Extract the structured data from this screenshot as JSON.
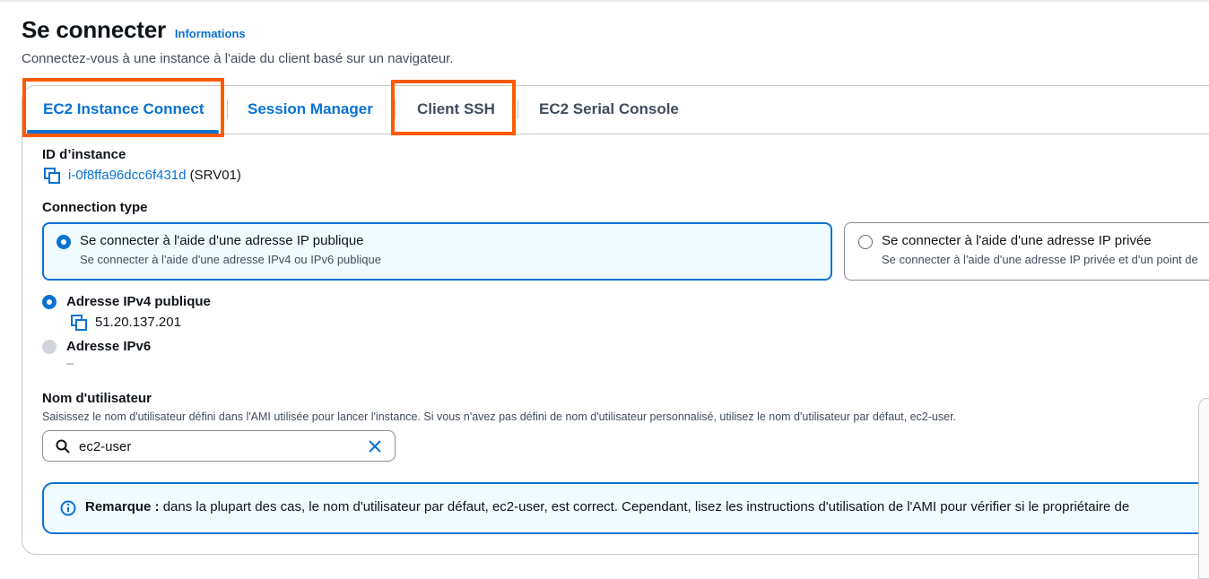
{
  "header": {
    "title": "Se connecter",
    "info_link": "Informations",
    "subtitle": "Connectez-vous à une instance à l'aide du client basé sur un navigateur."
  },
  "tabs": [
    {
      "label": "EC2 Instance Connect",
      "active": true,
      "highlighted": true
    },
    {
      "label": "Session Manager",
      "active": false,
      "highlighted": false
    },
    {
      "label": "Client SSH",
      "active": false,
      "highlighted": true
    },
    {
      "label": "EC2 Serial Console",
      "active": false,
      "highlighted": false
    }
  ],
  "instance": {
    "label": "ID d’instance",
    "id": "i-0f8ffa96dcc6f431d",
    "name": "(SRV01)"
  },
  "connection_type": {
    "label": "Connection type",
    "options": [
      {
        "title": "Se connecter à l'aide d'une adresse IP publique",
        "description": "Se connecter à l'aide d'une adresse IPv4 ou IPv6 publique",
        "selected": true
      },
      {
        "title": "Se connecter à l'aide d'une adresse IP privée",
        "description": "Se connecter à l'aide d'une adresse IP privée et d'un point de",
        "selected": false
      }
    ]
  },
  "ip_options": {
    "ipv4": {
      "label": "Adresse IPv4 publique",
      "value": "51.20.137.201",
      "selected": true
    },
    "ipv6": {
      "label": "Adresse IPv6",
      "value": "–",
      "selected": false
    }
  },
  "username": {
    "label": "Nom d'utilisateur",
    "description": "Saisissez le nom d'utilisateur défini dans l'AMI utilisée pour lancer l'instance. Si vous n'avez pas défini de nom d'utilisateur personnalisé, utilisez le nom d'utilisateur par défaut, ec2-user.",
    "value": "ec2-user"
  },
  "alert": {
    "bold": "Remarque :",
    "text": " dans la plupart des cas, le nom d'utilisateur par défaut, ec2-user, est correct. Cependant, lisez les instructions d'utilisation de l'AMI pour vérifier si le propriétaire de"
  },
  "colors": {
    "accent": "#0972d3",
    "highlight": "#ff5a00",
    "selected_bg": "#f0fbff"
  }
}
